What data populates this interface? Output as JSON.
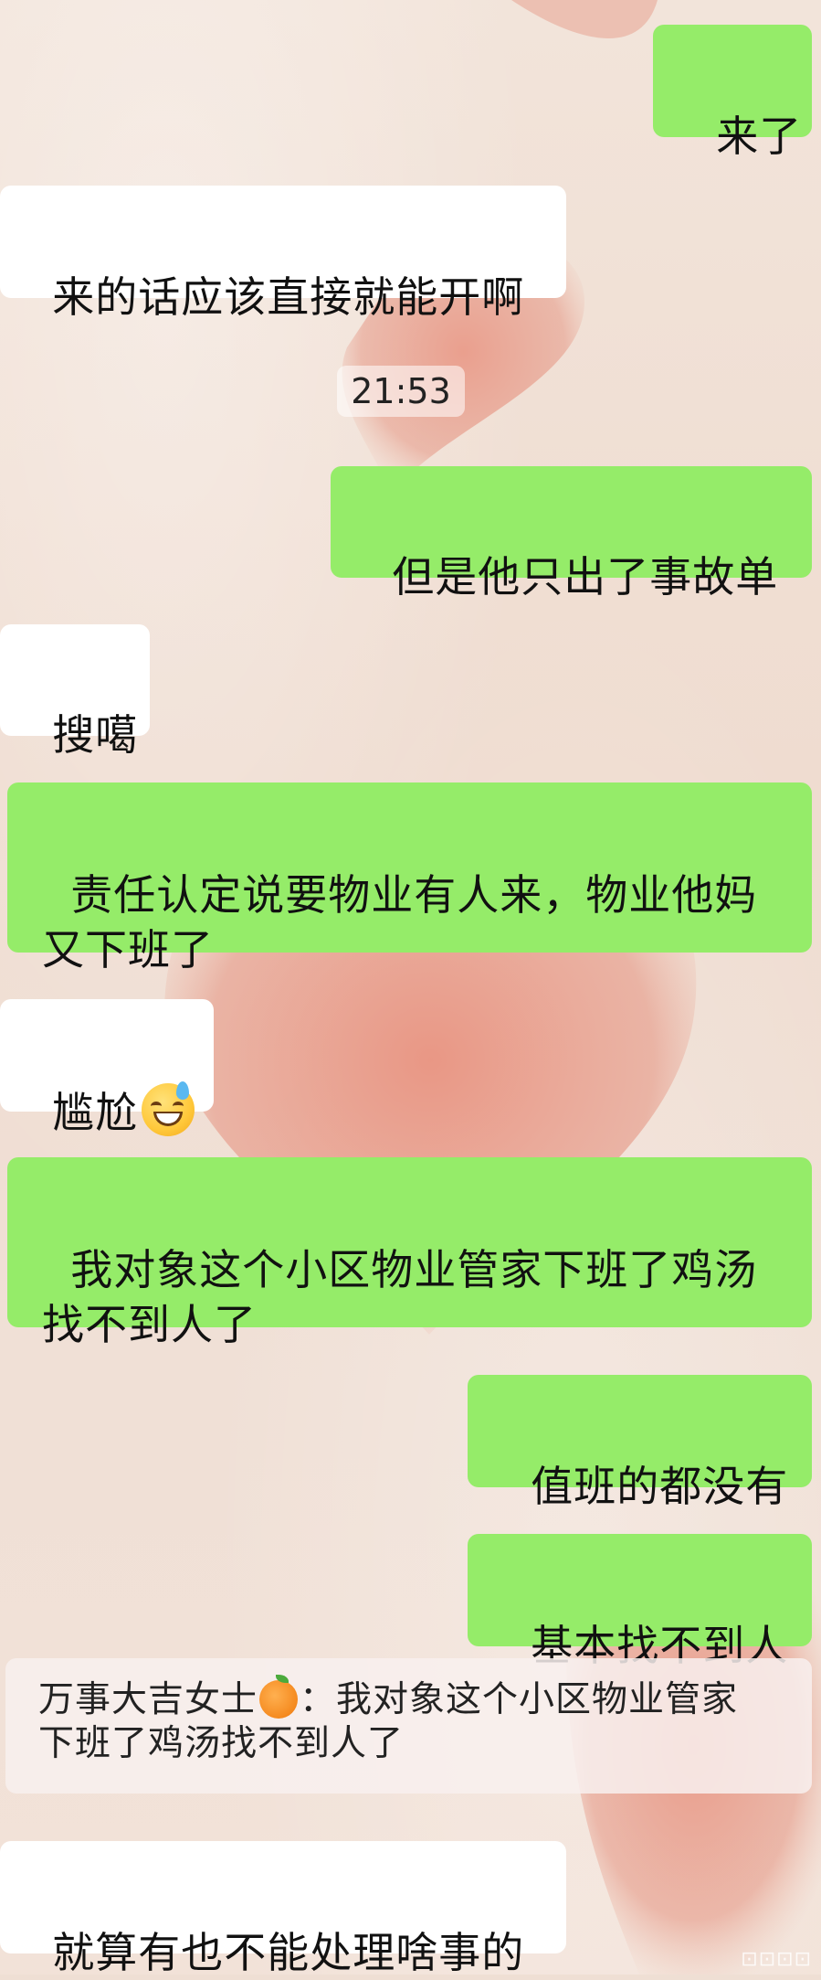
{
  "chat": {
    "messages": [
      {
        "side": "out",
        "text": "来了"
      },
      {
        "side": "in",
        "text": "来的话应该直接就能开啊"
      },
      {
        "side": "time",
        "text": "21:53"
      },
      {
        "side": "out",
        "text": "但是他只出了事故单"
      },
      {
        "side": "in",
        "text": "搜噶"
      },
      {
        "side": "out",
        "text": "责任认定说要物业有人来，物业他妈\n又下班了"
      },
      {
        "side": "in",
        "text": "尴尬",
        "emoji": "sweat-smile-icon"
      },
      {
        "side": "out",
        "text": "我对象这个小区物业管家下班了鸡汤\n找不到人了"
      },
      {
        "side": "out",
        "text": "值班的都没有"
      },
      {
        "side": "out",
        "text": "基本找不到人"
      },
      {
        "side": "in",
        "text": "就算有也不能处理啥事的"
      }
    ],
    "quote": {
      "sender": "万事大吉女士",
      "sender_emoji": "tangerine-icon",
      "separator": "：",
      "text": "我对象这个小区物业管家\n下班了鸡汤找不到人了"
    },
    "watermark": "⊡⊡⊡⊡"
  },
  "colors": {
    "outgoing_bubble": "#95ec69",
    "incoming_bubble": "#ffffff",
    "heart": "#e89a88"
  }
}
